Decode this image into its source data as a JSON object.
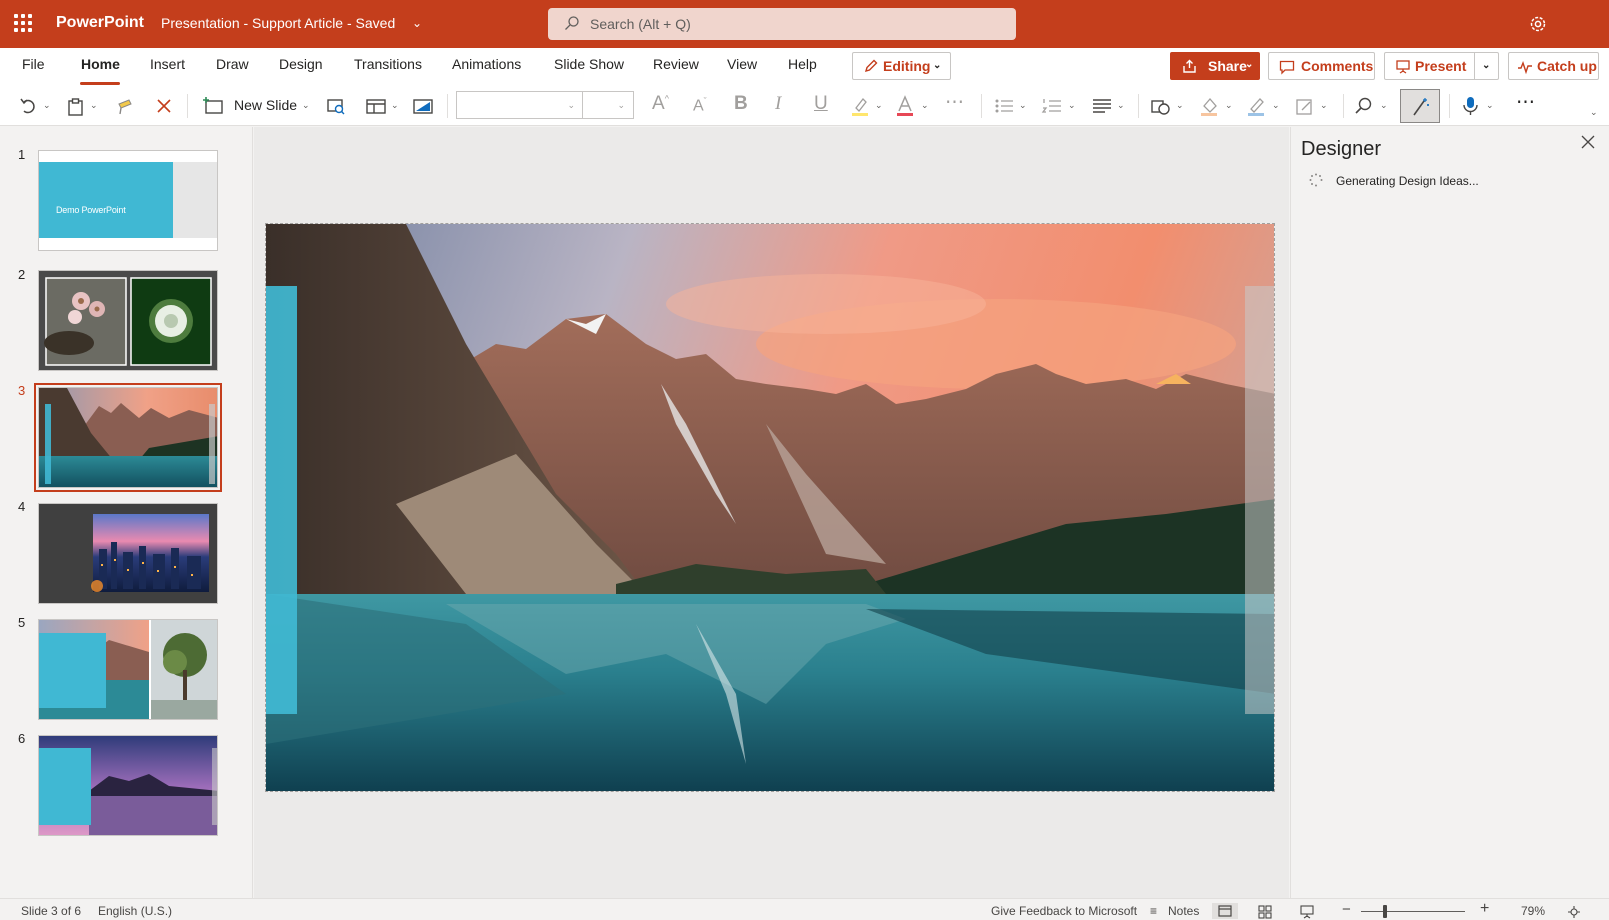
{
  "titlebar": {
    "app_name": "PowerPoint",
    "doc_title": "Presentation - Support Article  -  Saved",
    "search_placeholder": "Search (Alt + Q)",
    "accent_color": "#c43e1c"
  },
  "ribbon": {
    "tabs": [
      "File",
      "Home",
      "Insert",
      "Draw",
      "Design",
      "Transitions",
      "Animations",
      "Slide Show",
      "Review",
      "View",
      "Help"
    ],
    "active_tab": "Home",
    "editing_label": "Editing",
    "share_label": "Share",
    "comments_label": "Comments",
    "present_label": "Present",
    "catchup_label": "Catch up"
  },
  "toolbar": {
    "new_slide_label": "New Slide",
    "font_name": "",
    "font_size": "",
    "icons": [
      "undo-icon",
      "clipboard-icon",
      "format-painter-icon",
      "delete-icon",
      "new-slide-icon",
      "reuse-slides-icon",
      "layout-icon",
      "background-icon",
      "font-grow-icon",
      "font-shrink-icon",
      "bold-icon",
      "italic-icon",
      "underline-icon",
      "highlight-icon",
      "font-color-icon",
      "more-font-icon",
      "bullets-icon",
      "numbering-icon",
      "align-icon",
      "shapes-icon",
      "shape-fill-icon",
      "shape-outline-icon",
      "shape-effects-icon",
      "find-icon",
      "designer-icon",
      "dictate-icon",
      "more-icon"
    ]
  },
  "thumbnails": [
    {
      "number": "1",
      "text": "Demo PowerPoint"
    },
    {
      "number": "2",
      "text": ""
    },
    {
      "number": "3",
      "text": ""
    },
    {
      "number": "4",
      "text": ""
    },
    {
      "number": "5",
      "text": ""
    },
    {
      "number": "6",
      "text": ""
    }
  ],
  "selected_slide": 3,
  "designer": {
    "title": "Designer",
    "status": "Generating Design Ideas..."
  },
  "status": {
    "slide_position": "Slide 3 of 6",
    "language": "English (U.S.)",
    "feedback": "Give Feedback to Microsoft",
    "notes": "Notes",
    "zoom": "79%"
  }
}
